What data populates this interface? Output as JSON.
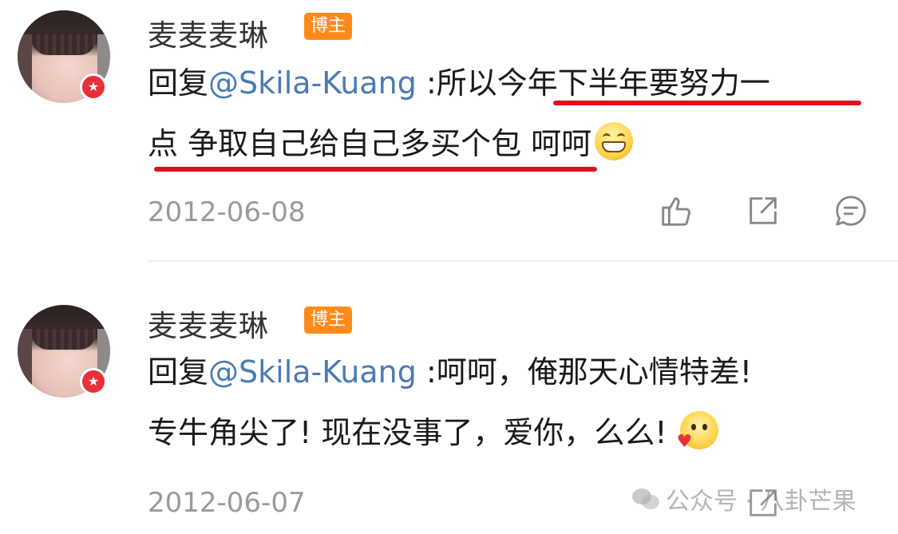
{
  "comments": [
    {
      "username": "麦麦麦琳",
      "role_badge": "博主",
      "reply_prefix": "回复",
      "mention": "@Skila-Kuang",
      "text_part1": " :所以今年下半年要努力一",
      "text_part2": "点 争取自己给自己多买个包 呵呵",
      "emoji": "grin-emoji",
      "date": "2012-06-08",
      "actions": [
        "like-icon",
        "share-icon",
        "comment-icon"
      ]
    },
    {
      "username": "麦麦麦琳",
      "role_badge": "博主",
      "reply_prefix": "回复",
      "mention": "@Skila-Kuang",
      "text_part1": " :呵呵，俺那天心情特差!",
      "text_part2": "专牛角尖了! 现在没事了，爱你，么么! ",
      "emoji": "love-emoji",
      "date": "2012-06-07",
      "actions": [
        "share-icon"
      ]
    }
  ],
  "watermark": "公众号 · 八卦芒果",
  "colors": {
    "mention": "#4a7ab5",
    "role_badge": "#ff8a1a",
    "underline": "#e0101c",
    "verified_badge": "#e8303a",
    "date": "#9a9a9a"
  }
}
